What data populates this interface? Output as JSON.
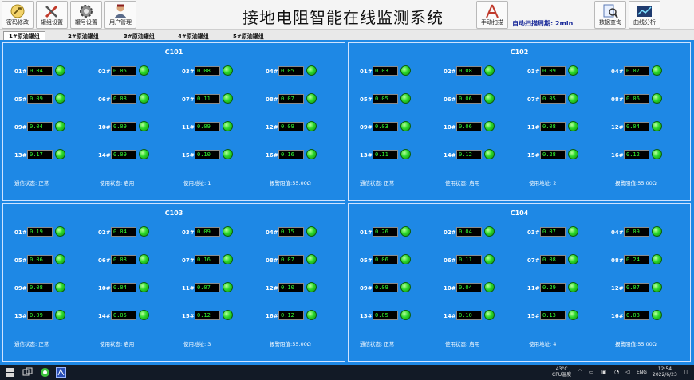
{
  "app": {
    "title": "接地电阻智能在线监测系统"
  },
  "toolbar": {
    "password_label": "密码修改",
    "tank_settings_label": "罐组设置",
    "tank_no_settings_label": "罐号设置",
    "user_mgmt_label": "用户管理",
    "manual_scan_label": "手动扫描",
    "auto_scan_text": "自动扫描周期: 2min",
    "data_query_label": "数据查询",
    "curve_analysis_label": "曲线分析"
  },
  "tabs": [
    {
      "label": "1#原油罐组",
      "active": true
    },
    {
      "label": "2#原油罐组",
      "active": false
    },
    {
      "label": "3#原油罐组",
      "active": false
    },
    {
      "label": "4#原油罐组",
      "active": false
    },
    {
      "label": "5#原油罐组",
      "active": false
    }
  ],
  "panels": [
    {
      "name": "C101",
      "sensors": [
        {
          "id": "01#",
          "value": "0.04"
        },
        {
          "id": "02#",
          "value": "0.05"
        },
        {
          "id": "03#",
          "value": "0.08"
        },
        {
          "id": "04#",
          "value": "0.05"
        },
        {
          "id": "05#",
          "value": "0.09"
        },
        {
          "id": "06#",
          "value": "0.08"
        },
        {
          "id": "07#",
          "value": "0.11"
        },
        {
          "id": "08#",
          "value": "0.07"
        },
        {
          "id": "09#",
          "value": "0.04"
        },
        {
          "id": "10#",
          "value": "0.09"
        },
        {
          "id": "11#",
          "value": "0.09"
        },
        {
          "id": "12#",
          "value": "0.09"
        },
        {
          "id": "13#",
          "value": "0.17"
        },
        {
          "id": "14#",
          "value": "0.09"
        },
        {
          "id": "15#",
          "value": "0.10"
        },
        {
          "id": "16#",
          "value": "0.16"
        }
      ],
      "comm_status": "通信状态: 正常",
      "usage_status": "使用状态: 启用",
      "address": "使用地址: 1",
      "alarm": "报警阻值:55.00Ω"
    },
    {
      "name": "C102",
      "sensors": [
        {
          "id": "01#",
          "value": "0.03"
        },
        {
          "id": "02#",
          "value": "0.08"
        },
        {
          "id": "03#",
          "value": "0.09"
        },
        {
          "id": "04#",
          "value": "0.07"
        },
        {
          "id": "05#",
          "value": "0.05"
        },
        {
          "id": "06#",
          "value": "0.06"
        },
        {
          "id": "07#",
          "value": "0.05"
        },
        {
          "id": "08#",
          "value": "0.06"
        },
        {
          "id": "09#",
          "value": "0.03"
        },
        {
          "id": "10#",
          "value": "0.06"
        },
        {
          "id": "11#",
          "value": "0.08"
        },
        {
          "id": "12#",
          "value": "0.04"
        },
        {
          "id": "13#",
          "value": "0.11"
        },
        {
          "id": "14#",
          "value": "0.12"
        },
        {
          "id": "15#",
          "value": "0.28"
        },
        {
          "id": "16#",
          "value": "0.12"
        }
      ],
      "comm_status": "通信状态: 正常",
      "usage_status": "使用状态: 启用",
      "address": "使用地址: 2",
      "alarm": "报警阻值:55.00Ω"
    },
    {
      "name": "C103",
      "sensors": [
        {
          "id": "01#",
          "value": "0.19"
        },
        {
          "id": "02#",
          "value": "0.04"
        },
        {
          "id": "03#",
          "value": "0.09"
        },
        {
          "id": "04#",
          "value": "0.15"
        },
        {
          "id": "05#",
          "value": "0.06"
        },
        {
          "id": "06#",
          "value": "0.08"
        },
        {
          "id": "07#",
          "value": "0.16"
        },
        {
          "id": "08#",
          "value": "0.07"
        },
        {
          "id": "09#",
          "value": "0.08"
        },
        {
          "id": "10#",
          "value": "0.04"
        },
        {
          "id": "11#",
          "value": "0.07"
        },
        {
          "id": "12#",
          "value": "0.10"
        },
        {
          "id": "13#",
          "value": "0.09"
        },
        {
          "id": "14#",
          "value": "0.05"
        },
        {
          "id": "15#",
          "value": "0.12"
        },
        {
          "id": "16#",
          "value": "0.12"
        }
      ],
      "comm_status": "通信状态: 正常",
      "usage_status": "使用状态: 启用",
      "address": "使用地址: 3",
      "alarm": "报警阻值:55.00Ω"
    },
    {
      "name": "C104",
      "sensors": [
        {
          "id": "01#",
          "value": "0.26"
        },
        {
          "id": "02#",
          "value": "0.04"
        },
        {
          "id": "03#",
          "value": "0.07"
        },
        {
          "id": "04#",
          "value": "0.09"
        },
        {
          "id": "05#",
          "value": "0.06"
        },
        {
          "id": "06#",
          "value": "0.11"
        },
        {
          "id": "07#",
          "value": "0.08"
        },
        {
          "id": "08#",
          "value": "0.24"
        },
        {
          "id": "09#",
          "value": "0.09"
        },
        {
          "id": "10#",
          "value": "0.04"
        },
        {
          "id": "11#",
          "value": "0.29"
        },
        {
          "id": "12#",
          "value": "0.07"
        },
        {
          "id": "13#",
          "value": "0.05"
        },
        {
          "id": "14#",
          "value": "0.10"
        },
        {
          "id": "15#",
          "value": "0.13"
        },
        {
          "id": "16#",
          "value": "0.08"
        }
      ],
      "comm_status": "通信状态: 正常",
      "usage_status": "使用状态: 启用",
      "address": "使用地址: 4",
      "alarm": "报警阻值:55.00Ω"
    }
  ],
  "taskbar": {
    "temp": "43°C",
    "temp_label": "CPU温度",
    "lang": "ENG",
    "time": "12:54",
    "date": "2022/6/23"
  },
  "colors": {
    "work_bg": "#1e88e5",
    "led_green": "#2bd92b",
    "value_text": "#33ff33",
    "taskbar": "#121a26"
  }
}
